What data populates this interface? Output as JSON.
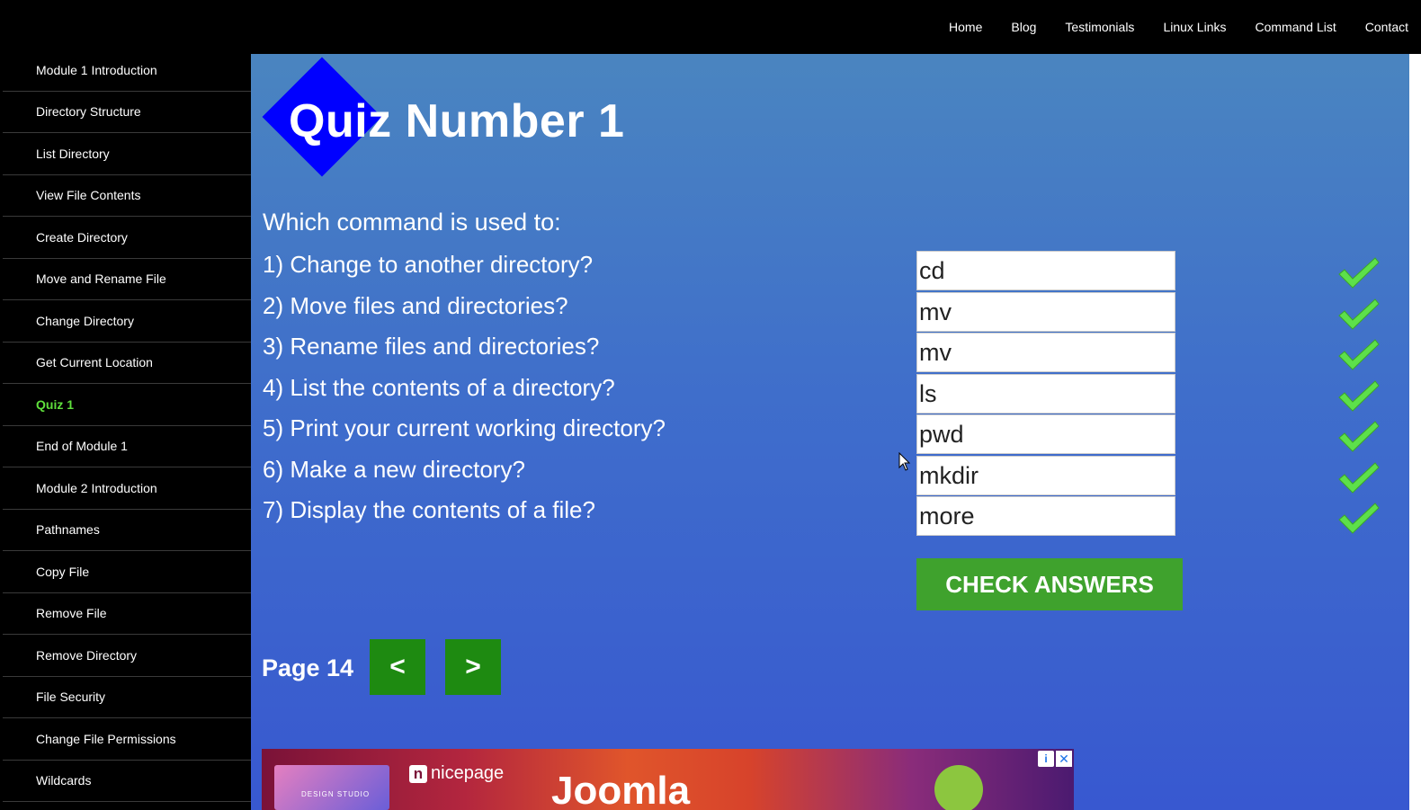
{
  "topnav": [
    "Home",
    "Blog",
    "Testimonials",
    "Linux Links",
    "Command List",
    "Contact"
  ],
  "sidebar": [
    {
      "label": "Module 1 Introduction"
    },
    {
      "label": "Directory Structure"
    },
    {
      "label": "List Directory"
    },
    {
      "label": "View File Contents"
    },
    {
      "label": "Create Directory"
    },
    {
      "label": "Move and Rename File"
    },
    {
      "label": "Change Directory"
    },
    {
      "label": "Get Current Location"
    },
    {
      "label": "Quiz 1",
      "active": true
    },
    {
      "label": "End of Module 1"
    },
    {
      "label": "Module 2 Introduction"
    },
    {
      "label": "Pathnames"
    },
    {
      "label": "Copy File"
    },
    {
      "label": "Remove File"
    },
    {
      "label": "Remove Directory"
    },
    {
      "label": "File Security"
    },
    {
      "label": "Change File Permissions"
    },
    {
      "label": "Wildcards"
    }
  ],
  "quiz": {
    "title": "Quiz Number 1",
    "intro": "Which command is used to:",
    "questions": [
      {
        "text": "1) Change to another directory?",
        "answer": "cd",
        "correct": true
      },
      {
        "text": "2) Move files and directories?",
        "answer": "mv",
        "correct": true
      },
      {
        "text": "3) Rename files and directories?",
        "answer": "mv",
        "correct": true
      },
      {
        "text": "4) List the contents of a directory?",
        "answer": "ls",
        "correct": true
      },
      {
        "text": "5) Print your current working directory?",
        "answer": "pwd",
        "correct": true
      },
      {
        "text": "6) Make a new directory?",
        "answer": "mkdir",
        "correct": true
      },
      {
        "text": "7) Display the contents of a file?",
        "answer": "more",
        "correct": true
      }
    ],
    "check_label": "CHECK ANSWERS"
  },
  "pager": {
    "label": "Page 14",
    "prev": "<",
    "next": ">"
  },
  "ad": {
    "brand": "nicepage",
    "headline": "Joomla",
    "thumb_text": "DESIGN STUDIO",
    "info": "i",
    "close": "✕"
  },
  "colors": {
    "accent_green": "#3fa22d",
    "active_nav": "#5fe03c",
    "logo_blue": "#0000ff",
    "check_green": "#5de04a"
  }
}
